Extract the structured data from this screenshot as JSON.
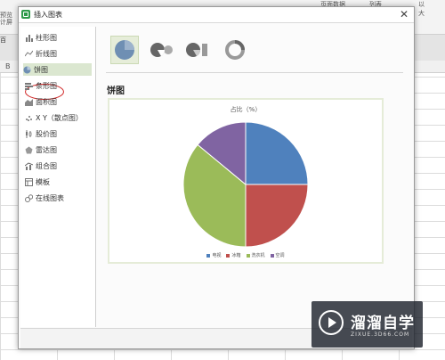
{
  "background": {
    "left_text": "预览\n计屏",
    "left_tab": "百",
    "col_header": "B",
    "top_text_1": "页面数据",
    "top_text_2": "列表",
    "right_text_1": "以",
    "right_text_2": "大"
  },
  "dialog": {
    "title": "插入图表",
    "close_glyph": "✕"
  },
  "sidebar": {
    "items": [
      {
        "label": "柱形图",
        "icon": "column-chart-icon"
      },
      {
        "label": "折线图",
        "icon": "line-chart-icon"
      },
      {
        "label": "饼图",
        "icon": "pie-chart-icon",
        "selected": true
      },
      {
        "label": "条形图",
        "icon": "bar-chart-icon"
      },
      {
        "label": "面积图",
        "icon": "area-chart-icon"
      },
      {
        "label": "X Y（散点图）",
        "icon": "scatter-chart-icon"
      },
      {
        "label": "股价图",
        "icon": "stock-chart-icon"
      },
      {
        "label": "雷达图",
        "icon": "radar-chart-icon"
      },
      {
        "label": "组合图",
        "icon": "combo-chart-icon"
      },
      {
        "label": "模板",
        "icon": "template-icon"
      },
      {
        "label": "在线图表",
        "icon": "online-chart-icon"
      }
    ]
  },
  "content": {
    "subtypes": [
      "pie",
      "exploded-pie",
      "bar-of-pie",
      "doughnut"
    ],
    "section_title": "饼图"
  },
  "chart_data": {
    "type": "pie",
    "title": "占比（%）",
    "categories": [
      "电视",
      "冰箱",
      "洗衣机",
      "空调"
    ],
    "values": [
      25,
      25,
      36,
      14
    ],
    "colors": [
      "#4f81bd",
      "#c0504d",
      "#9bbb59",
      "#8064a2"
    ],
    "legend": "bottom"
  },
  "watermark": {
    "text": "溜溜自学",
    "url": "ZIXUE.3D66.COM"
  }
}
